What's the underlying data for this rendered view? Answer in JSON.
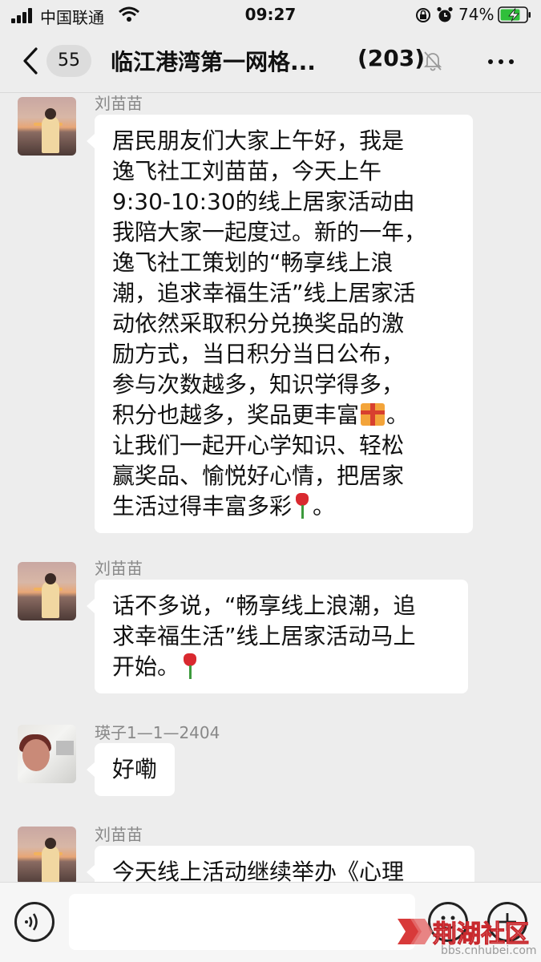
{
  "status_bar": {
    "carrier": "中国联通",
    "time": "09:27",
    "battery_percent": "74%"
  },
  "nav": {
    "unread_count": "55",
    "title": "临江港湾第一网格...",
    "member_count": "(203)"
  },
  "messages": [
    {
      "sender": "刘苗苗",
      "avatar": "sunset-avatar",
      "lines": [
        "居民朋友们大家上午好，我是",
        "逸飞社工刘苗苗，今天上午",
        "9:30-10:30的线上居家活动由",
        "我陪大家一起度过。新的一年，",
        "逸飞社工策划的“畅享线上浪",
        "潮，追求幸福生活”线上居家活",
        "动依然采取积分兑换奖品的激",
        "励方式，当日积分当日公布，",
        "参与次数越多，知识学得多，",
        "积分也越多，奖品更丰富",
        "让我们一起开心学知识、轻松",
        "赢奖品、愉悦好心情，把居家",
        "生活过得丰富多彩"
      ],
      "line10_tail": "。",
      "line13_tail": "。"
    },
    {
      "sender": "刘苗苗",
      "avatar": "sunset-avatar",
      "lines": [
        "话不多说，“畅享线上浪潮，追",
        "求幸福生活”线上居家活动马上",
        "开始。"
      ]
    },
    {
      "sender": "瑛子1—1—2404",
      "avatar": "photo-avatar",
      "lines": [
        "好嘞"
      ]
    },
    {
      "sender": "刘苗苗",
      "avatar": "sunset-avatar",
      "lines": [
        "今天线上活动继续举办《心理"
      ]
    }
  ],
  "watermark": {
    "text": "荆湖社区",
    "url": "bbs.cnhubei.com"
  },
  "colors": {
    "background": "#ededed",
    "bubble": "#ffffff",
    "sender_name": "#888888",
    "watermark_red": "#c8282d"
  }
}
